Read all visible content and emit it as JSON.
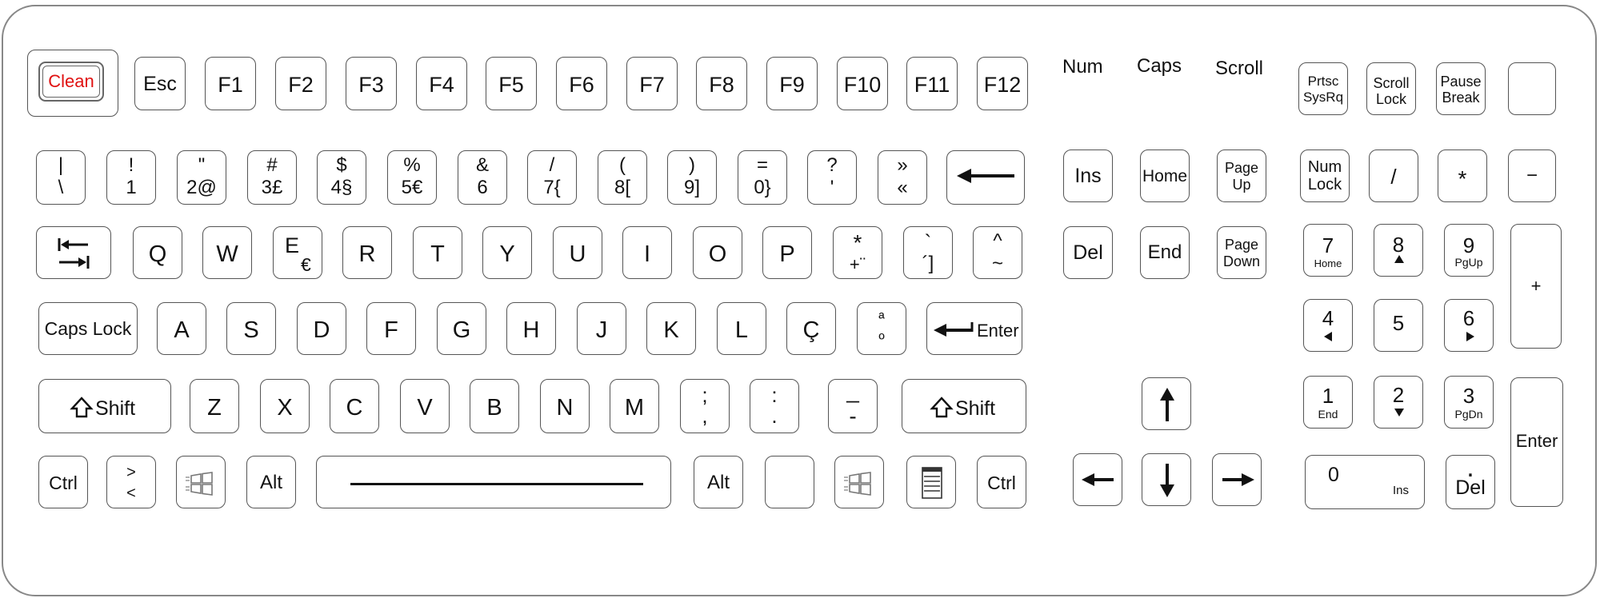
{
  "indicators": {
    "num": "Num",
    "caps": "Caps",
    "scroll": "Scroll"
  },
  "keys": {
    "clean": "Clean",
    "esc": "Esc",
    "f1": "F1",
    "f2": "F2",
    "f3": "F3",
    "f4": "F4",
    "f5": "F5",
    "f6": "F6",
    "f7": "F7",
    "f8": "F8",
    "f9": "F9",
    "f10": "F10",
    "f11": "F11",
    "f12": "F12",
    "prtsc_top": "Prtsc",
    "prtsc_bottom": "SysRq",
    "scroll_top": "Scroll",
    "scroll_bottom": "Lock",
    "pause_top": "Pause",
    "pause_bottom": "Break",
    "n_pipe_top": "|",
    "n_pipe_bottom": "\\",
    "n1_top": "!",
    "n1_bottom": "1",
    "n2_top": "\"",
    "n2_bottom": "2@",
    "n3_top": "#",
    "n3_bottom": "3£",
    "n4_top": "$",
    "n4_bottom": "4§",
    "n5_top": "%",
    "n5_bottom": "5€",
    "n6_top": "&",
    "n6_bottom": "6",
    "n7_top": "/",
    "n7_bottom": "7{",
    "n8_top": "(",
    "n8_bottom": "8[",
    "n9_top": ")",
    "n9_bottom": "9]",
    "n0_top": "=",
    "n0_bottom": "0}",
    "nq_top": "?",
    "nq_bottom": "'",
    "ng_top": "»",
    "ng_bottom": "«",
    "q": "Q",
    "w": "W",
    "e": "E",
    "e_alt": "€",
    "r": "R",
    "t": "T",
    "y": "Y",
    "u": "U",
    "i": "I",
    "o": "O",
    "p": "P",
    "star_top": "*",
    "star_bottom": "+¨",
    "grave_top": "`",
    "grave_bottom": "´]",
    "caret_top": "^",
    "caret_bottom": "~",
    "caps_lock": "Caps Lock",
    "a": "A",
    "s": "S",
    "d": "D",
    "f": "F",
    "g": "G",
    "h": "H",
    "j": "J",
    "k": "K",
    "l": "L",
    "cced": "Ç",
    "ord_top": "ª",
    "ord_bottom": "º",
    "enter": "Enter",
    "shift": "Shift",
    "z": "Z",
    "x": "X",
    "c": "C",
    "v": "V",
    "b": "B",
    "n": "N",
    "m": "M",
    "semi_top": ";",
    "semi_bottom": ",",
    "colon_top": ":",
    "colon_bottom": ".",
    "under_top": "_",
    "under_bottom": "-",
    "ctrl": "Ctrl",
    "angle_top": ">",
    "angle_bottom": "<",
    "alt": "Alt",
    "ins": "Ins",
    "home": "Home",
    "pgup_top": "Page",
    "pgup_bottom": "Up",
    "del": "Del",
    "end": "End",
    "pgdn_top": "Page",
    "pgdn_bottom": "Down",
    "numlock_top": "Num",
    "numlock_bottom": "Lock",
    "kp_slash": "/",
    "kp_star": "*",
    "kp_minus": "−",
    "kp_plus": "+",
    "kp7": "7",
    "kp7_sub": "Home",
    "kp8": "8",
    "kp9": "9",
    "kp9_sub": "PgUp",
    "kp4": "4",
    "kp5": "5",
    "kp6": "6",
    "kp1": "1",
    "kp1_sub": "End",
    "kp2": "2",
    "kp3": "3",
    "kp3_sub": "PgDn",
    "kp0": "0",
    "kp0_sub": "Ins",
    "kpdot": ".",
    "kpdot_sub": "Del",
    "kp_enter": "Enter"
  },
  "colors": {
    "clean_text": "#e01010",
    "key_border": "#555555"
  }
}
